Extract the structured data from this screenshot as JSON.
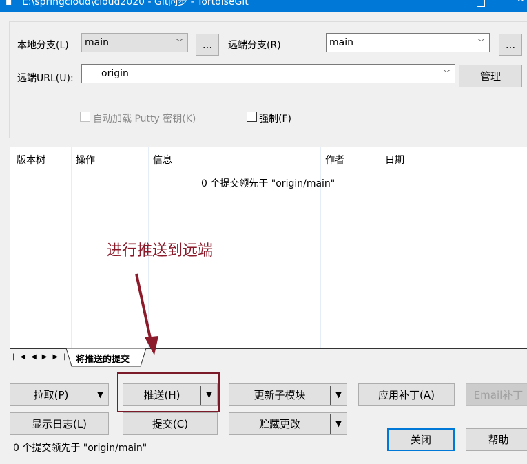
{
  "window": {
    "title": "E:\\springcloud\\cloud2020 - Git同步 - TortoiseGit",
    "maximize_icon": "maximize-icon",
    "close_icon": "close-icon"
  },
  "form": {
    "local_branch_label": "本地分支(L)",
    "local_branch_value": "main",
    "remote_branch_label": "远端分支(R)",
    "remote_branch_value": "main",
    "browse_label": "...",
    "remote_url_label": "远端URL(U):",
    "remote_url_value": "origin",
    "manage_label": "管理",
    "autoload_putty_label": "自动加载 Putty 密钥(K)",
    "autoload_putty_checked": false,
    "autoload_putty_enabled": false,
    "force_label": "强制(F)",
    "force_checked": false
  },
  "list": {
    "columns": [
      "版本树",
      "操作",
      "信息",
      "作者",
      "日期"
    ],
    "message": "0 个提交领先于 \"origin/main\""
  },
  "tabs": {
    "nav": [
      "|◀",
      "◀",
      "▶",
      "▶|"
    ],
    "active": "将推送的提交"
  },
  "annotation": {
    "text": "进行推送到远端",
    "color": "#8b1a2a"
  },
  "buttons": {
    "pull": "拉取(P)",
    "push": "推送(H)",
    "update_submodules": "更新子模块",
    "apply_patch": "应用补丁(A)",
    "email_patch": "Email补丁",
    "show_log": "显示日志(L)",
    "commit": "提交(C)",
    "stash": "贮藏更改",
    "close": "关闭",
    "help": "帮助"
  },
  "status": "0 个提交领先于 \"origin/main\"",
  "colors": {
    "titlebar": "#0078d7",
    "default_button_border": "#0078d7"
  }
}
